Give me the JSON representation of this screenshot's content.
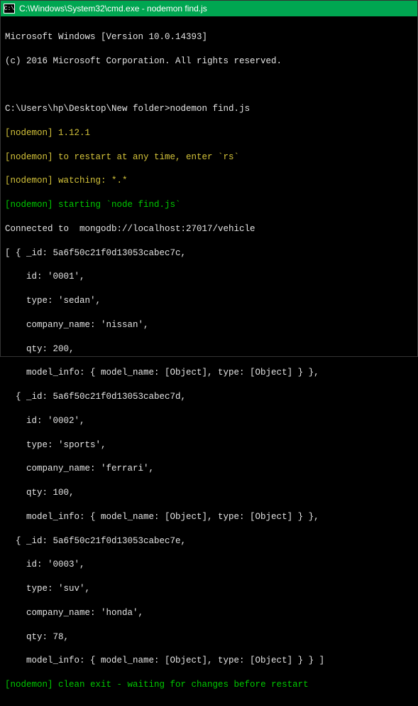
{
  "titlebar": {
    "icon_text": "C:\\",
    "title": "C:\\Windows\\System32\\cmd.exe - nodemon  find.js"
  },
  "header": {
    "line1": "Microsoft Windows [Version 10.0.14393]",
    "line2": "(c) 2016 Microsoft Corporation. All rights reserved."
  },
  "prompt": {
    "path": "C:\\Users\\hp\\Desktop\\New folder>",
    "command": "nodemon find.js"
  },
  "nodemon": {
    "prefix": "[nodemon]",
    "version": " 1.12.1",
    "restart": " to restart at any time, enter `rs`",
    "watching": " watching: *.*",
    "starting": " starting `node find.js`",
    "clean_exit": " clean exit - waiting for changes before restart"
  },
  "output": {
    "connected": "Connected to  mongodb://localhost:27017/vehicle",
    "l01": "[ { _id: 5a6f50c21f0d13053cabec7c,",
    "l02": "    id: '0001',",
    "l03": "    type: 'sedan',",
    "l04": "    company_name: 'nissan',",
    "l05": "    qty: 200,",
    "l06": "    model_info: { model_name: [Object], type: [Object] } },",
    "l07": "  { _id: 5a6f50c21f0d13053cabec7d,",
    "l08": "    id: '0002',",
    "l09": "    type: 'sports',",
    "l10": "    company_name: 'ferrari',",
    "l11": "    qty: 100,",
    "l12": "    model_info: { model_name: [Object], type: [Object] } },",
    "l13": "  { _id: 5a6f50c21f0d13053cabec7e,",
    "l14": "    id: '0003',",
    "l15": "    type: 'suv',",
    "l16": "    company_name: 'honda',",
    "l17": "    qty: 78,",
    "l18": "    model_info: { model_name: [Object], type: [Object] } } ]"
  }
}
